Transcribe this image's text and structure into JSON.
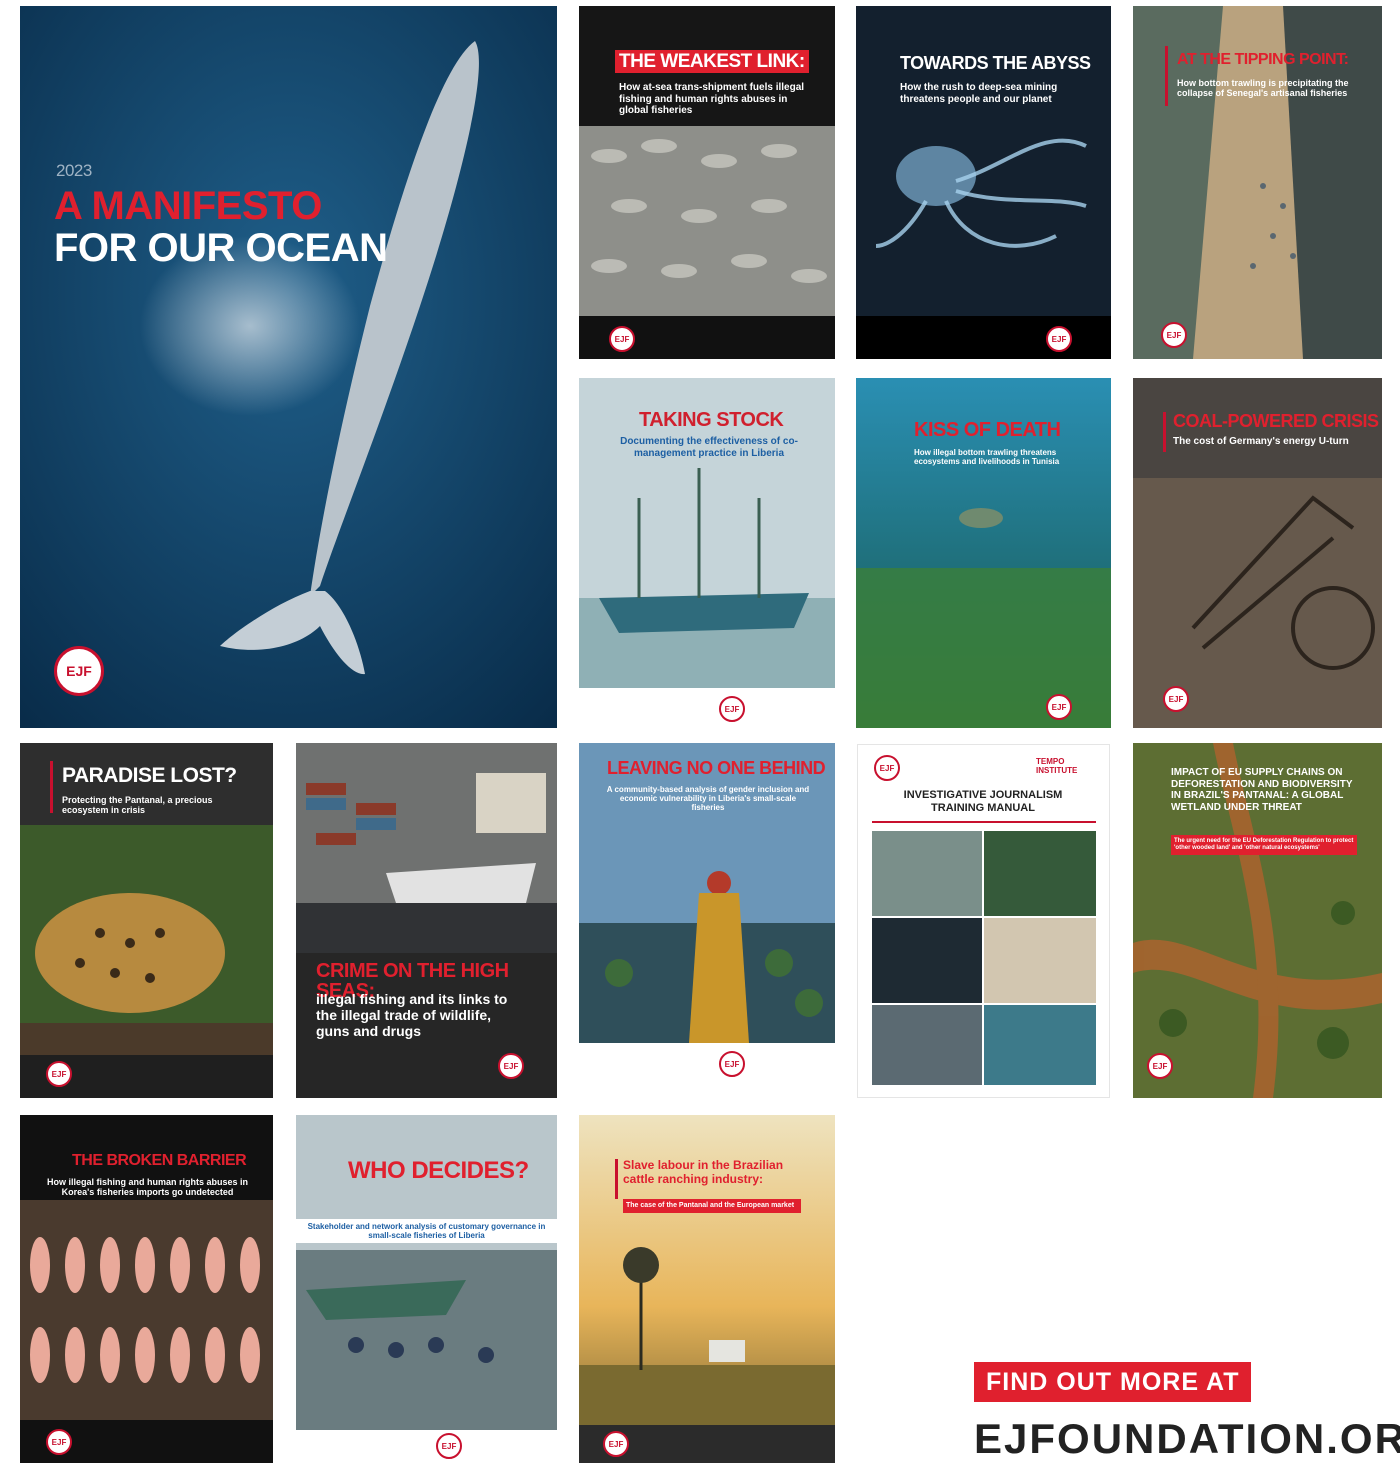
{
  "covers": {
    "manifesto": {
      "year": "2023",
      "title_red": "A MANIFESTO",
      "title_white": "FOR OUR OCEAN",
      "logo": "EJF"
    },
    "weakest_link": {
      "title": "THE WEAKEST LINK:",
      "subtitle": "How at-sea trans-shipment fuels illegal fishing and human rights abuses in global fisheries",
      "logo": "EJF"
    },
    "abyss": {
      "title": "TOWARDS THE ABYSS",
      "subtitle": "How the rush to deep-sea mining threatens people and our planet",
      "logo": "EJF"
    },
    "tipping_point": {
      "title": "AT THE TIPPING POINT:",
      "subtitle": "How bottom trawling is precipitating the collapse of Senegal's artisanal fisheries",
      "logo": "EJF"
    },
    "taking_stock": {
      "title": "TAKING STOCK",
      "subtitle": "Documenting the effectiveness of co-management practice in Liberia",
      "logo": "EJF"
    },
    "kiss_of_death": {
      "title": "KISS OF DEATH",
      "subtitle": "How illegal bottom trawling threatens ecosystems and livelihoods in Tunisia",
      "logo": "EJF"
    },
    "coal_crisis": {
      "title": "COAL-POWERED CRISIS",
      "subtitle": "The cost of Germany's energy U-turn",
      "logo": "EJF"
    },
    "paradise_lost": {
      "title": "PARADISE LOST?",
      "subtitle": "Protecting the Pantanal, a precious ecosystem in crisis",
      "logo": "EJF"
    },
    "crime_high_seas": {
      "title": "CRIME ON THE HIGH SEAS:",
      "subtitle": "illegal fishing and its links to the illegal trade of wildlife, guns and drugs",
      "logo": "EJF"
    },
    "leaving_no_one": {
      "title": "LEAVING NO ONE BEHIND",
      "subtitle": "A community-based analysis of gender inclusion and economic vulnerability in Liberia's small-scale fisheries",
      "logo": "EJF"
    },
    "journalism": {
      "title": "INVESTIGATIVE JOURNALISM TRAINING MANUAL",
      "partner": "TEMPO INSTITUTE",
      "logo": "EJF"
    },
    "eu_supply": {
      "title": "IMPACT OF EU SUPPLY CHAINS ON DEFORESTATION AND BIODIVERSITY IN BRAZIL'S PANTANAL: A GLOBAL WETLAND UNDER THREAT",
      "subtitle": "The urgent need for the EU Deforestation Regulation to protect 'other wooded land' and 'other natural ecosystems'",
      "logo": "EJF"
    },
    "broken_barrier": {
      "title": "THE BROKEN BARRIER",
      "subtitle": "How illegal fishing and human rights abuses in Korea's fisheries imports go undetected",
      "logo": "EJF"
    },
    "who_decides": {
      "title": "WHO DECIDES?",
      "subtitle": "Stakeholder and network analysis of customary governance in small-scale fisheries of Liberia",
      "logo": "EJF"
    },
    "slave_labour": {
      "title": "Slave labour in the Brazilian cattle ranching industry:",
      "subtitle": "The case of the Pantanal and the European market",
      "logo": "EJF"
    }
  },
  "cta": {
    "label": "FIND OUT MORE AT",
    "url": "EJFOUNDATION.ORG"
  }
}
